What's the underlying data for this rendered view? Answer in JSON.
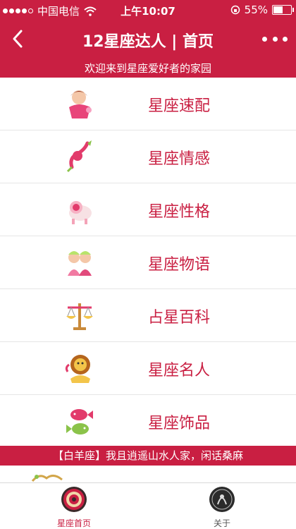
{
  "statusbar": {
    "carrier": "中国电信",
    "time": "上午10:07",
    "battery": "55%",
    "battery_level": 0.55,
    "signal_bars": 4
  },
  "navbar": {
    "title": "12星座达人 | 首页",
    "back_icon": "chevron-left-icon",
    "more_icon": "more-dots-icon"
  },
  "welcome": "欢迎来到星座爱好者的家园",
  "menu": [
    {
      "label": "星座速配",
      "icon": "virgo-icon"
    },
    {
      "label": "星座情感",
      "icon": "scorpio-icon"
    },
    {
      "label": "星座性格",
      "icon": "aries-icon"
    },
    {
      "label": "星座物语",
      "icon": "gemini-icon"
    },
    {
      "label": "占星百科",
      "icon": "libra-icon"
    },
    {
      "label": "星座名人",
      "icon": "leo-icon"
    },
    {
      "label": "星座饰品",
      "icon": "pisces-icon"
    }
  ],
  "ticker": "【白羊座】我且逍遥山水人家，闲话桑麻",
  "tabs": [
    {
      "label": "星座首页",
      "icon": "zodiac-wheel-icon",
      "active": true
    },
    {
      "label": "关于",
      "icon": "about-emblem-icon",
      "active": false
    }
  ],
  "colors": {
    "brand": "#c91f42",
    "text": "#ffffff"
  }
}
